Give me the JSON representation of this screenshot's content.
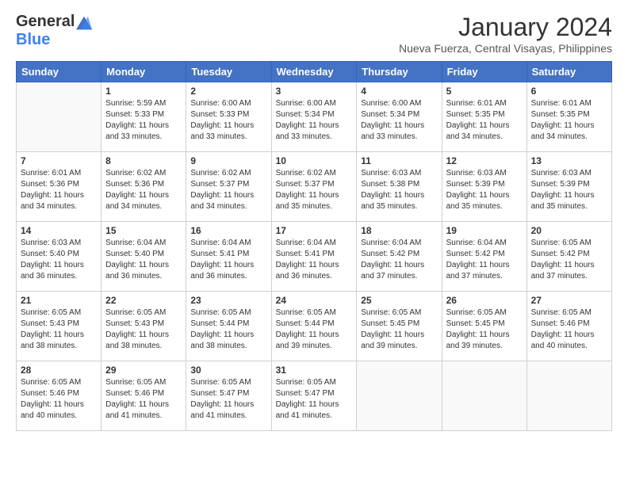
{
  "logo": {
    "general": "General",
    "blue": "Blue"
  },
  "title": "January 2024",
  "location": "Nueva Fuerza, Central Visayas, Philippines",
  "weekdays": [
    "Sunday",
    "Monday",
    "Tuesday",
    "Wednesday",
    "Thursday",
    "Friday",
    "Saturday"
  ],
  "weeks": [
    [
      {
        "day": "",
        "sunrise": "",
        "sunset": "",
        "daylight": ""
      },
      {
        "day": "1",
        "sunrise": "Sunrise: 5:59 AM",
        "sunset": "Sunset: 5:33 PM",
        "daylight": "Daylight: 11 hours and 33 minutes."
      },
      {
        "day": "2",
        "sunrise": "Sunrise: 6:00 AM",
        "sunset": "Sunset: 5:33 PM",
        "daylight": "Daylight: 11 hours and 33 minutes."
      },
      {
        "day": "3",
        "sunrise": "Sunrise: 6:00 AM",
        "sunset": "Sunset: 5:34 PM",
        "daylight": "Daylight: 11 hours and 33 minutes."
      },
      {
        "day": "4",
        "sunrise": "Sunrise: 6:00 AM",
        "sunset": "Sunset: 5:34 PM",
        "daylight": "Daylight: 11 hours and 33 minutes."
      },
      {
        "day": "5",
        "sunrise": "Sunrise: 6:01 AM",
        "sunset": "Sunset: 5:35 PM",
        "daylight": "Daylight: 11 hours and 34 minutes."
      },
      {
        "day": "6",
        "sunrise": "Sunrise: 6:01 AM",
        "sunset": "Sunset: 5:35 PM",
        "daylight": "Daylight: 11 hours and 34 minutes."
      }
    ],
    [
      {
        "day": "7",
        "sunrise": "Sunrise: 6:01 AM",
        "sunset": "Sunset: 5:36 PM",
        "daylight": "Daylight: 11 hours and 34 minutes."
      },
      {
        "day": "8",
        "sunrise": "Sunrise: 6:02 AM",
        "sunset": "Sunset: 5:36 PM",
        "daylight": "Daylight: 11 hours and 34 minutes."
      },
      {
        "day": "9",
        "sunrise": "Sunrise: 6:02 AM",
        "sunset": "Sunset: 5:37 PM",
        "daylight": "Daylight: 11 hours and 34 minutes."
      },
      {
        "day": "10",
        "sunrise": "Sunrise: 6:02 AM",
        "sunset": "Sunset: 5:37 PM",
        "daylight": "Daylight: 11 hours and 35 minutes."
      },
      {
        "day": "11",
        "sunrise": "Sunrise: 6:03 AM",
        "sunset": "Sunset: 5:38 PM",
        "daylight": "Daylight: 11 hours and 35 minutes."
      },
      {
        "day": "12",
        "sunrise": "Sunrise: 6:03 AM",
        "sunset": "Sunset: 5:39 PM",
        "daylight": "Daylight: 11 hours and 35 minutes."
      },
      {
        "day": "13",
        "sunrise": "Sunrise: 6:03 AM",
        "sunset": "Sunset: 5:39 PM",
        "daylight": "Daylight: 11 hours and 35 minutes."
      }
    ],
    [
      {
        "day": "14",
        "sunrise": "Sunrise: 6:03 AM",
        "sunset": "Sunset: 5:40 PM",
        "daylight": "Daylight: 11 hours and 36 minutes."
      },
      {
        "day": "15",
        "sunrise": "Sunrise: 6:04 AM",
        "sunset": "Sunset: 5:40 PM",
        "daylight": "Daylight: 11 hours and 36 minutes."
      },
      {
        "day": "16",
        "sunrise": "Sunrise: 6:04 AM",
        "sunset": "Sunset: 5:41 PM",
        "daylight": "Daylight: 11 hours and 36 minutes."
      },
      {
        "day": "17",
        "sunrise": "Sunrise: 6:04 AM",
        "sunset": "Sunset: 5:41 PM",
        "daylight": "Daylight: 11 hours and 36 minutes."
      },
      {
        "day": "18",
        "sunrise": "Sunrise: 6:04 AM",
        "sunset": "Sunset: 5:42 PM",
        "daylight": "Daylight: 11 hours and 37 minutes."
      },
      {
        "day": "19",
        "sunrise": "Sunrise: 6:04 AM",
        "sunset": "Sunset: 5:42 PM",
        "daylight": "Daylight: 11 hours and 37 minutes."
      },
      {
        "day": "20",
        "sunrise": "Sunrise: 6:05 AM",
        "sunset": "Sunset: 5:42 PM",
        "daylight": "Daylight: 11 hours and 37 minutes."
      }
    ],
    [
      {
        "day": "21",
        "sunrise": "Sunrise: 6:05 AM",
        "sunset": "Sunset: 5:43 PM",
        "daylight": "Daylight: 11 hours and 38 minutes."
      },
      {
        "day": "22",
        "sunrise": "Sunrise: 6:05 AM",
        "sunset": "Sunset: 5:43 PM",
        "daylight": "Daylight: 11 hours and 38 minutes."
      },
      {
        "day": "23",
        "sunrise": "Sunrise: 6:05 AM",
        "sunset": "Sunset: 5:44 PM",
        "daylight": "Daylight: 11 hours and 38 minutes."
      },
      {
        "day": "24",
        "sunrise": "Sunrise: 6:05 AM",
        "sunset": "Sunset: 5:44 PM",
        "daylight": "Daylight: 11 hours and 39 minutes."
      },
      {
        "day": "25",
        "sunrise": "Sunrise: 6:05 AM",
        "sunset": "Sunset: 5:45 PM",
        "daylight": "Daylight: 11 hours and 39 minutes."
      },
      {
        "day": "26",
        "sunrise": "Sunrise: 6:05 AM",
        "sunset": "Sunset: 5:45 PM",
        "daylight": "Daylight: 11 hours and 39 minutes."
      },
      {
        "day": "27",
        "sunrise": "Sunrise: 6:05 AM",
        "sunset": "Sunset: 5:46 PM",
        "daylight": "Daylight: 11 hours and 40 minutes."
      }
    ],
    [
      {
        "day": "28",
        "sunrise": "Sunrise: 6:05 AM",
        "sunset": "Sunset: 5:46 PM",
        "daylight": "Daylight: 11 hours and 40 minutes."
      },
      {
        "day": "29",
        "sunrise": "Sunrise: 6:05 AM",
        "sunset": "Sunset: 5:46 PM",
        "daylight": "Daylight: 11 hours and 41 minutes."
      },
      {
        "day": "30",
        "sunrise": "Sunrise: 6:05 AM",
        "sunset": "Sunset: 5:47 PM",
        "daylight": "Daylight: 11 hours and 41 minutes."
      },
      {
        "day": "31",
        "sunrise": "Sunrise: 6:05 AM",
        "sunset": "Sunset: 5:47 PM",
        "daylight": "Daylight: 11 hours and 41 minutes."
      },
      {
        "day": "",
        "sunrise": "",
        "sunset": "",
        "daylight": ""
      },
      {
        "day": "",
        "sunrise": "",
        "sunset": "",
        "daylight": ""
      },
      {
        "day": "",
        "sunrise": "",
        "sunset": "",
        "daylight": ""
      }
    ]
  ]
}
